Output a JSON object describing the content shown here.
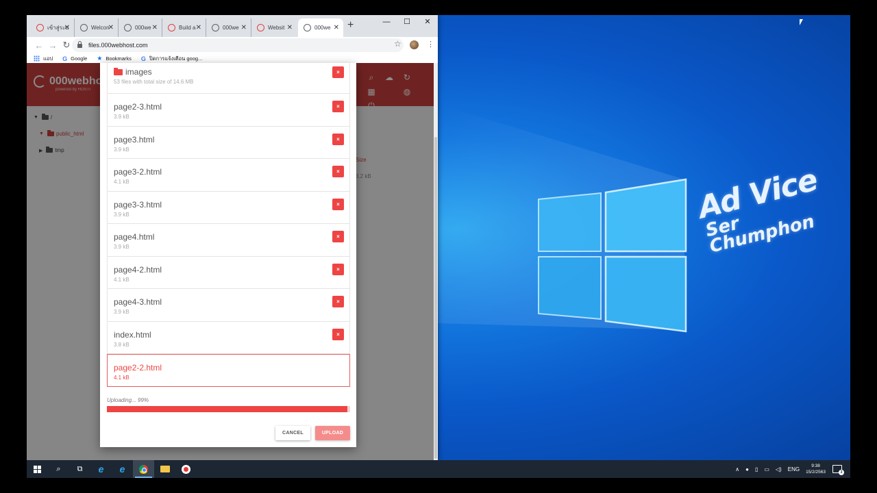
{
  "browser": {
    "tabs": [
      {
        "label": "เข้าสู่ระบ",
        "favicon": "webhost-red-icon"
      },
      {
        "label": "Welcon",
        "favicon": "globe-icon"
      },
      {
        "label": "000we",
        "favicon": "globe-icon"
      },
      {
        "label": "Build a",
        "favicon": "webhost-red-icon"
      },
      {
        "label": "000we",
        "favicon": "globe-icon"
      },
      {
        "label": "Websit",
        "favicon": "webhost-red-icon"
      },
      {
        "label": "000we",
        "favicon": "globe-icon",
        "active": true
      }
    ],
    "url": "files.000webhost.com",
    "bookmarks": [
      "แอป",
      "Google",
      "Bookmarks",
      "ปิดการแจ้งเตือน goog..."
    ]
  },
  "file_manager": {
    "brand": "000webho",
    "brand_sub": "powered by HOSTI",
    "tree": [
      "/",
      "public_html",
      "tmp"
    ],
    "column_size": "Size",
    "cell_size": "3.2 kB"
  },
  "upload_dialog": {
    "files": [
      {
        "name": "images",
        "size": "53 files with total size of 14.6 MB",
        "folder": true
      },
      {
        "name": "page2-3.html",
        "size": "3.9 kB"
      },
      {
        "name": "page3.html",
        "size": "3.9 kB"
      },
      {
        "name": "page3-2.html",
        "size": "4.1 kB"
      },
      {
        "name": "page3-3.html",
        "size": "3.9 kB"
      },
      {
        "name": "page4.html",
        "size": "3.9 kB"
      },
      {
        "name": "page4-2.html",
        "size": "4.1 kB"
      },
      {
        "name": "page4-3.html",
        "size": "3.9 kB"
      },
      {
        "name": "index.html",
        "size": "3.8 kB"
      },
      {
        "name": "page2-2.html",
        "size": "4.1 kB",
        "uploading": true
      }
    ],
    "remove_label": "×",
    "status": "Uploading... 99%",
    "progress": 0.99,
    "cancel_label": "CANCEL",
    "upload_label": "UPLOAD"
  },
  "desktop": {
    "logo_line1": "Ad Vice",
    "logo_line2": "Ser",
    "logo_line3": "Chumphon"
  },
  "taskbar": {
    "language": "ENG",
    "time": "9:38",
    "date": "15/2/2563",
    "notifications": "3"
  },
  "colors": {
    "accent": "#c9413f",
    "danger": "#ee4444",
    "desktop": "#0a58c9"
  }
}
